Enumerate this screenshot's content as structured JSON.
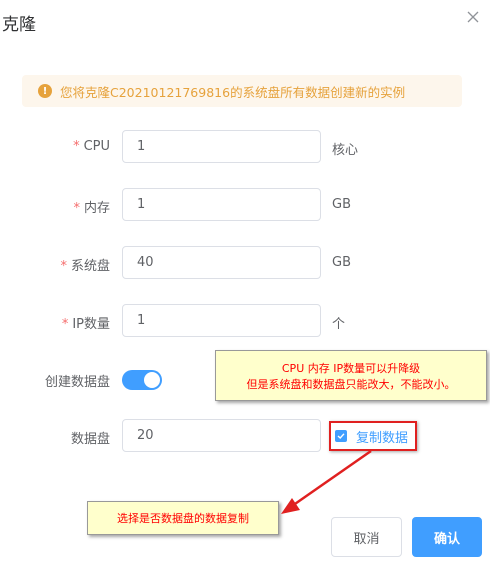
{
  "dialog": {
    "title": "克隆",
    "alert": "您将克隆C20210121769816的系统盘所有数据创建新的实例"
  },
  "form": {
    "cpu": {
      "label": "CPU",
      "value": "1",
      "unit": "核心"
    },
    "memory": {
      "label": "内存",
      "value": "1",
      "unit": "GB"
    },
    "system_disk": {
      "label": "系统盘",
      "value": "40",
      "unit": "GB"
    },
    "ip_count": {
      "label": "IP数量",
      "value": "1",
      "unit": "个"
    },
    "create_data_disk": {
      "label": "创建数据盘",
      "enabled": true
    },
    "data_disk": {
      "label": "数据盘",
      "value": "20",
      "copy_label": "复制数据",
      "copy_checked": true
    }
  },
  "annotations": {
    "note1_line1": "CPU 内存 IP数量可以升降级",
    "note1_line2": "但是系统盘和数据盘只能改大，不能改小。",
    "note2": "选择是否数据盘的数据复制"
  },
  "buttons": {
    "cancel": "取消",
    "confirm": "确认"
  },
  "colors": {
    "primary": "#409eff",
    "warning": "#e6a23c",
    "required": "#f56c6c",
    "annotation": "#ff0000",
    "note_bg": "#ffffcc"
  }
}
